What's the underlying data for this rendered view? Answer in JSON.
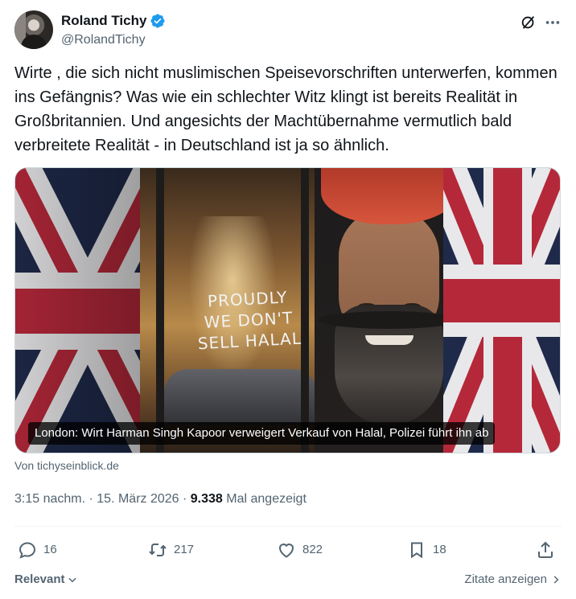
{
  "author": {
    "display_name": "Roland Tichy",
    "handle": "@RolandTichy",
    "verified_icon": "verified-badge-icon"
  },
  "tweet": {
    "text": "Wirte , die sich nicht muslimischen Speisevorschriften unterwerfen, kommen ins Gefängnis? Was wie ein schlechter Witz klingt ist bereits Realität in Großbritannien. Und angesichts der Machtübernahme vermutlich bald verbreitete Realität - in Deutschland ist ja so ähnlich."
  },
  "media": {
    "graffiti_line1": "PROUDLY",
    "graffiti_line2": "WE DON'T",
    "graffiti_line3": "SELL HALAL",
    "caption": "London: Wirt Harman Singh Kapoor verweigert Verkauf von Halal, Polizei führt ihn ab"
  },
  "link_source": "Von tichyseinblick.de",
  "meta": {
    "time": "3:15 nachm.",
    "separator": " · ",
    "date": "15. März 2026",
    "views_count": "9.338",
    "views_label": " Mal angezeigt"
  },
  "actions": {
    "replies": "16",
    "reposts": "217",
    "likes": "822",
    "bookmarks": "18"
  },
  "footer": {
    "sort_label": "Relevant",
    "quotes_label": "Zitate anzeigen"
  },
  "colors": {
    "text_primary": "#0f1419",
    "text_secondary": "#536471",
    "verified": "#1d9bf0",
    "divider": "#eff3f4"
  }
}
